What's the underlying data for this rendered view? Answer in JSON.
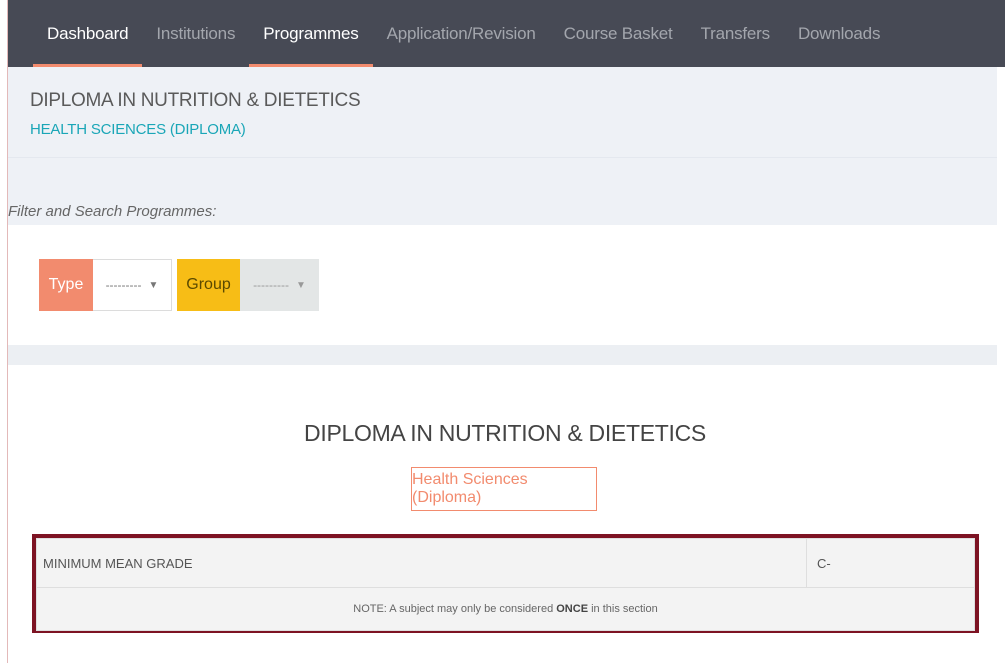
{
  "nav": {
    "items": [
      {
        "label": "Dashboard",
        "active": true
      },
      {
        "label": "Institutions",
        "active": false
      },
      {
        "label": "Programmes",
        "active": true
      },
      {
        "label": "Application/Revision",
        "active": false
      },
      {
        "label": "Course Basket",
        "active": false
      },
      {
        "label": "Transfers",
        "active": false
      },
      {
        "label": "Downloads",
        "active": false
      }
    ]
  },
  "header": {
    "title": "DIPLOMA IN NUTRITION & DIETETICS",
    "subtitle": "HEALTH SCIENCES (DIPLOMA)"
  },
  "filter": {
    "label": "Filter and Search Programmes:",
    "type_label": "Type",
    "type_value": "---------",
    "group_label": "Group",
    "group_value": "---------"
  },
  "programme": {
    "title": "DIPLOMA IN NUTRITION & DIETETICS",
    "category_button": "Health Sciences (Diploma)"
  },
  "requirements": {
    "row_label": "MINIMUM MEAN GRADE",
    "row_value": "C-",
    "note_prefix": "NOTE: A subject may only be considered",
    "note_emphasis": "ONCE",
    "note_suffix": "in this section"
  },
  "colors": {
    "nav_bg": "#474a55",
    "accent": "#f28b6e",
    "subtitle": "#1aa6b7",
    "group_label": "#f7bd16",
    "highlight_border": "#7d1323"
  }
}
